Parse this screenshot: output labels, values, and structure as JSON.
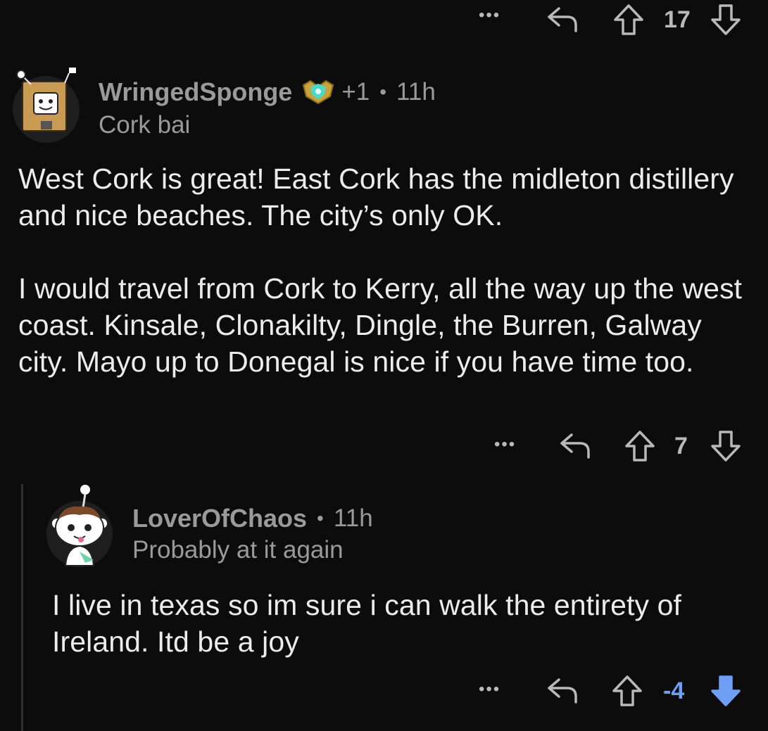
{
  "top_actions": {
    "more_label": "•••",
    "score": "17"
  },
  "comment1": {
    "username": "WringedSponge",
    "award_count": "+1",
    "separator": "•",
    "time": "11h",
    "flair": "Cork bai",
    "paragraph1": "West Cork is great! East Cork has the midleton distillery and nice beaches. The city’s only OK.",
    "paragraph2": "I would travel from Cork to Kerry, all the way up the west coast. Kinsale, Clonakilty, Dingle, the Burren, Galway city. Mayo up to Donegal is nice if you have time too.",
    "more_label": "•••",
    "score": "7"
  },
  "comment2": {
    "username": "LoverOfChaos",
    "separator": "•",
    "time": "11h",
    "flair": "Probably at it again",
    "paragraph1": "I live in texas so im sure i can walk the entirety of Ireland. Itd be a joy",
    "more_label": "•••",
    "score": "-4",
    "vote_state": "downvoted"
  },
  "colors": {
    "background": "#0c0c0c",
    "text": "#ececec",
    "muted": "#9a9a9a",
    "downvote_active": "#6f9ff5"
  }
}
